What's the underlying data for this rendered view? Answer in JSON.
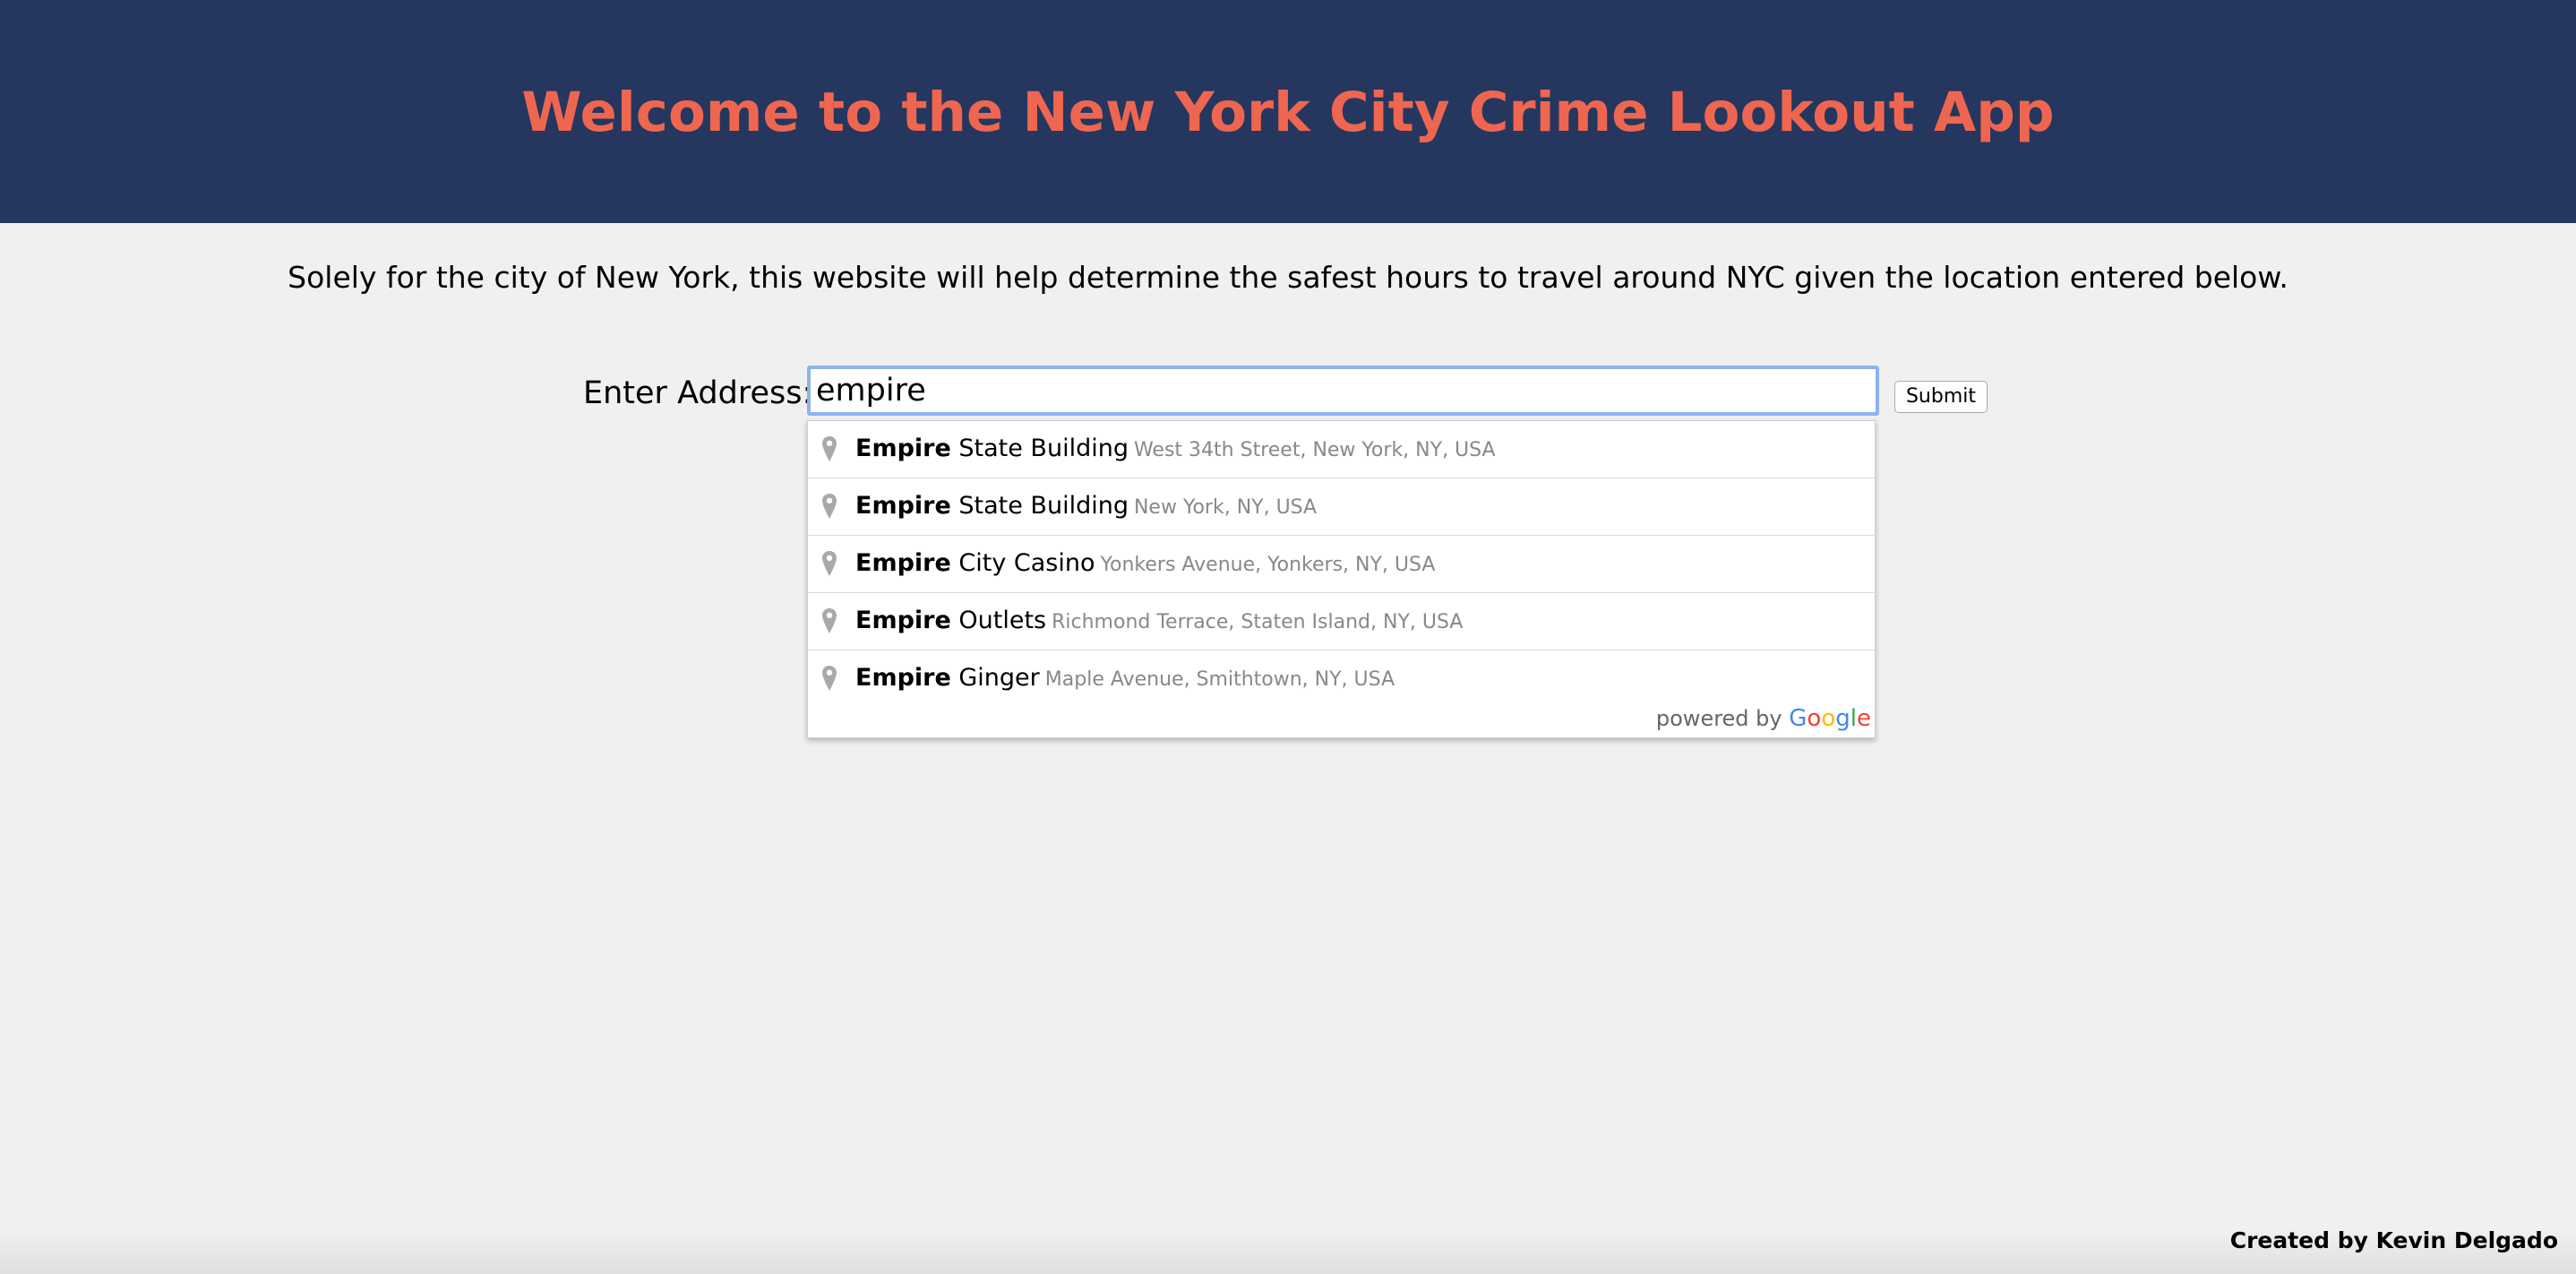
{
  "header": {
    "title": "Welcome to the New York City Crime Lookout App",
    "background_color": "#25375e",
    "title_color": "#ef6650"
  },
  "main": {
    "description": "Solely for the city of New York, this website will help determine the safest hours to travel around NYC given the location entered below.",
    "address_label": "Enter Address:",
    "address_value": "empire",
    "submit_label": "Submit"
  },
  "autocomplete": {
    "suggestions": [
      {
        "match": "Empire",
        "rest": " State Building",
        "secondary": "West 34th Street, New York, NY, USA",
        "icon": "map-pin-icon"
      },
      {
        "match": "Empire",
        "rest": " State Building",
        "secondary": "New York, NY, USA",
        "icon": "map-pin-icon"
      },
      {
        "match": "Empire",
        "rest": " City Casino",
        "secondary": "Yonkers Avenue, Yonkers, NY, USA",
        "icon": "map-pin-icon"
      },
      {
        "match": "Empire",
        "rest": " Outlets",
        "secondary": "Richmond Terrace, Staten Island, NY, USA",
        "icon": "map-pin-icon"
      },
      {
        "match": "Empire",
        "rest": " Ginger",
        "secondary": "Maple Avenue, Smithtown, NY, USA",
        "icon": "map-pin-icon"
      }
    ],
    "powered_by": "powered by",
    "google_logo_letters": [
      {
        "char": "G",
        "color": "#4285f4"
      },
      {
        "char": "o",
        "color": "#ea4335"
      },
      {
        "char": "o",
        "color": "#fbbc05"
      },
      {
        "char": "g",
        "color": "#4285f4"
      },
      {
        "char": "l",
        "color": "#34a853"
      },
      {
        "char": "e",
        "color": "#ea4335"
      }
    ]
  },
  "footer": {
    "credit": "Created by Kevin Delgado"
  }
}
